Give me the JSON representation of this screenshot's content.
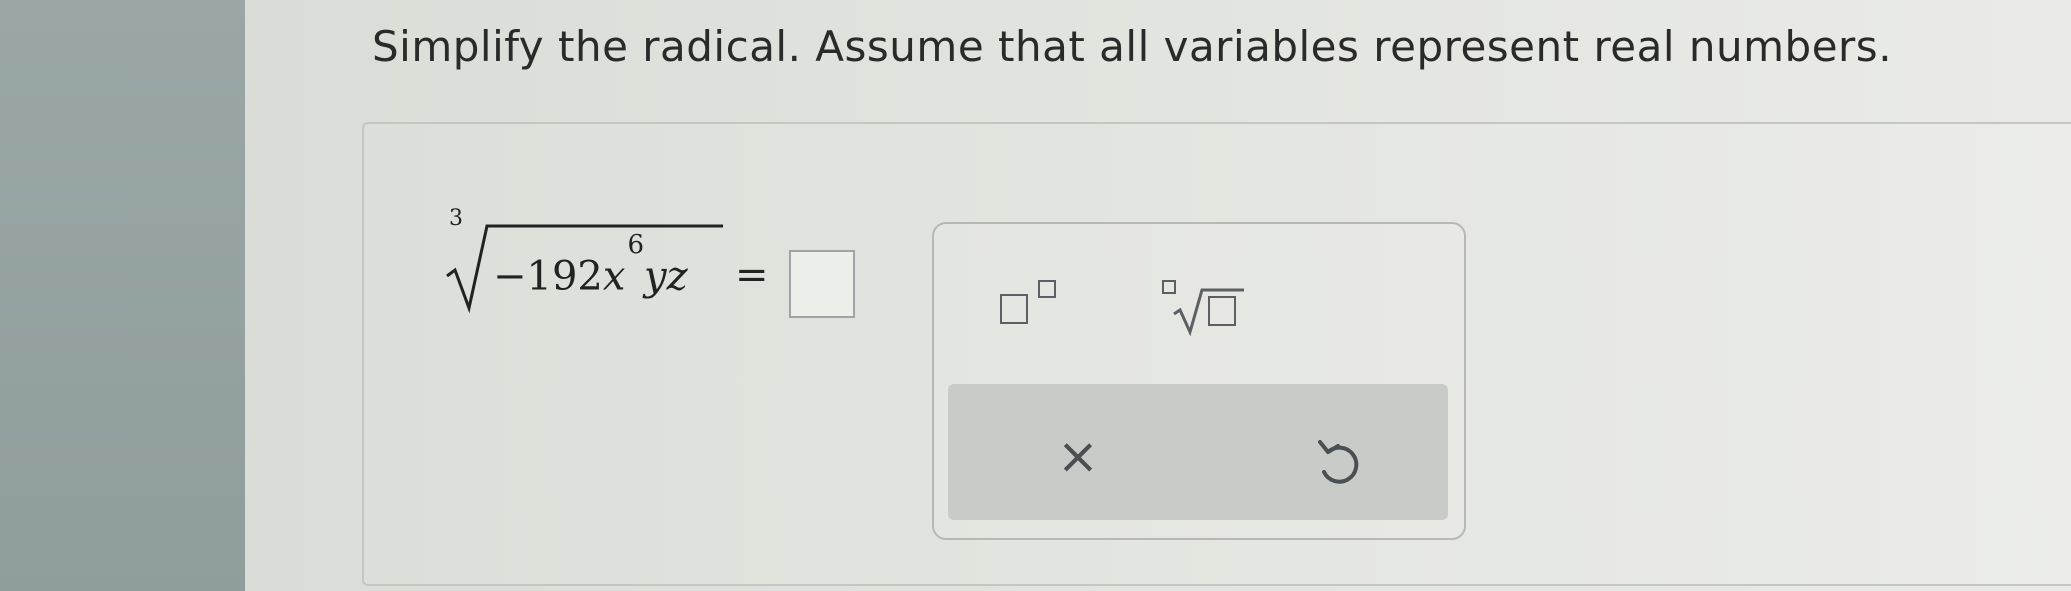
{
  "question": {
    "prompt": "Simplify the radical. Assume that all variables represent real numbers."
  },
  "expression": {
    "root_index": "3",
    "coefficient": "−192",
    "var_x": "x",
    "x_exponent": "6",
    "var_yz": "yz",
    "equals": "="
  },
  "answer": {
    "value": ""
  },
  "palette": {
    "exponent_icon": "exponent-template-icon",
    "nth_root_icon": "nth-root-template-icon",
    "clear_symbol": "×",
    "clear_icon": "clear-icon",
    "undo_icon": "undo-icon"
  },
  "colors": {
    "text": "#2a2a2a",
    "icon": "#5b6064",
    "action_bar": "#c9cbc8"
  }
}
